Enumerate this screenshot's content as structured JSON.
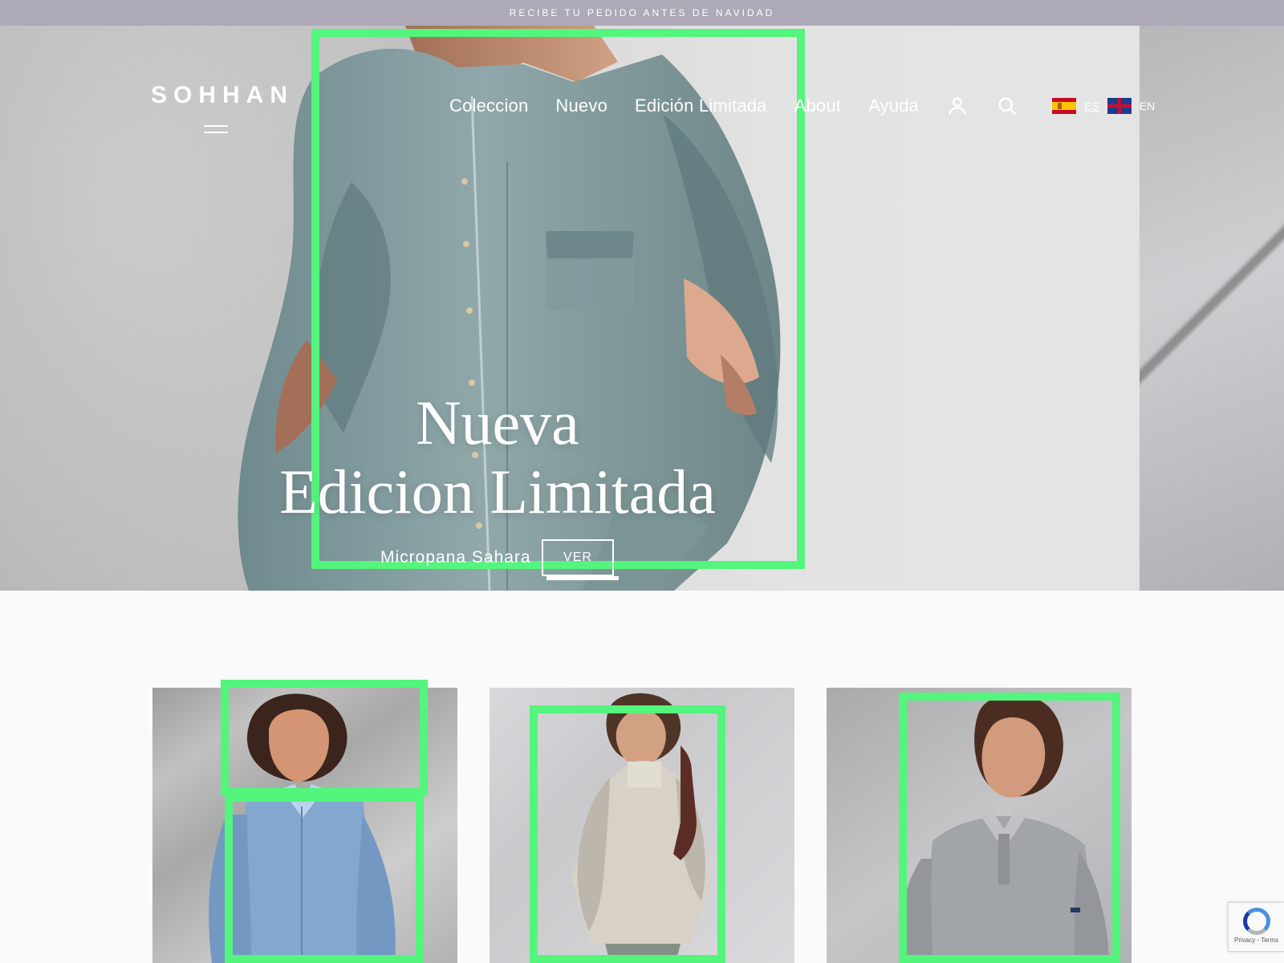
{
  "announcement": {
    "text": "RECIBE TU PEDIDO ANTES DE NAVIDAD"
  },
  "header": {
    "logo": "SOHHAN",
    "nav_items": [
      "Coleccion",
      "Nuevo",
      "Edición Limitada",
      "About",
      "Ayuda"
    ],
    "languages": [
      {
        "code": "ES",
        "flag": "spain-flag-icon"
      },
      {
        "code": "EN",
        "flag": "uk-flag-icon"
      }
    ],
    "icons": [
      "menu-icon",
      "user-icon",
      "search-icon"
    ]
  },
  "hero": {
    "title_line_1": "Nueva",
    "title_line_2": "Edicion Limitada",
    "subtitle": "Micropana Sahara",
    "button_label": "VER"
  },
  "products": [
    {
      "alt": "blue-shirt-model"
    },
    {
      "alt": "beige-knit-model"
    },
    {
      "alt": "grey-polo-model"
    }
  ],
  "recaptcha": {
    "terms": "Privacy - Terms"
  },
  "colors": {
    "announcement_bg": "#ada9b7",
    "highlight": "#53f57c",
    "hero_text": "#ffffff"
  }
}
